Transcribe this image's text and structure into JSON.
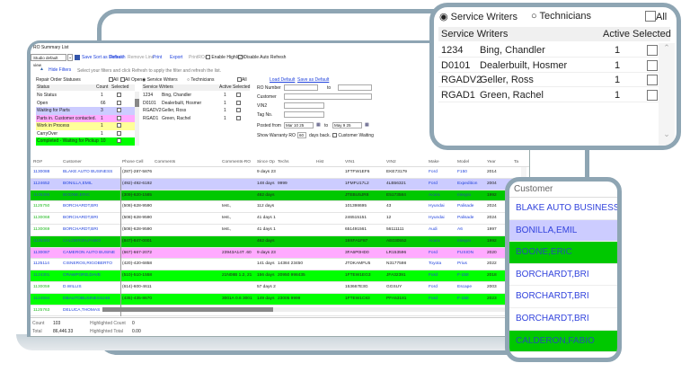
{
  "window": {
    "title": "RO Summary List"
  },
  "toolbar": {
    "view": "Studio default view",
    "save_sort": "Save Sort as Default",
    "refresh": "Refresh",
    "remove_line": "Remove Line",
    "print": "Print",
    "export": "Export",
    "print_ros": "PrintROs",
    "enable_highlight": "Enable Highlight",
    "disable_auto_refresh": "Disable Auto Refresh"
  },
  "filters": {
    "hide": "Hide Filters",
    "hint": "Select your filters and click Refresh to apply the filter and refresh the list.",
    "statuses_title": "Repair Order Statuses",
    "all": "All",
    "all_open": "All Open",
    "col_status": "Status",
    "col_count": "Count",
    "col_selected": "Selected",
    "statuses": [
      {
        "name": "No Status",
        "count": "1",
        "color": "#ffffff"
      },
      {
        "name": "Open",
        "count": "66",
        "color": "#ffffff"
      },
      {
        "name": "Waiting for Parts",
        "count": "3",
        "color": "#ccccff"
      },
      {
        "name": "Parts in. Customer contacted.",
        "count": "1",
        "color": "#ffaaff"
      },
      {
        "name": "Work in Process",
        "count": "1",
        "color": "#ffff99"
      },
      {
        "name": "CarryOver",
        "count": "1",
        "color": "#ffffff"
      },
      {
        "name": "Completed - Waiting for Pickup",
        "count": "10",
        "color": "#00ff00"
      }
    ],
    "service_writers_radio": "Service Writers",
    "technicians_radio": "Technicians",
    "col_sw": "Service Writers",
    "col_active": "Active",
    "writers": [
      {
        "code": "1234",
        "name": "Bing, Chandler",
        "active": "1"
      },
      {
        "code": "D0101",
        "name": "Dealerbuilt, Hosmer",
        "active": "1"
      },
      {
        "code": "RGADV2",
        "name": "Geller, Ross",
        "active": "1"
      },
      {
        "code": "RGAD1",
        "name": "Green, Rachel",
        "active": "1"
      }
    ],
    "load_default": "Load Default",
    "save_default": "Save as Default",
    "ro_number": "RO Number",
    "to": "to",
    "customer": "Customer",
    "vin2": "VIN2",
    "tag_no": "Tag No.",
    "posted_from": "Posted from",
    "posted_from_value": "Mar 10 25",
    "posted_to_value": "May 9 25",
    "show_warranty": "Show Warranty RO",
    "warranty_days": "60",
    "days_back": "days back.",
    "customer_waiting": "Customer Waiting"
  },
  "grid": {
    "headers": [
      "RO#",
      "Customer",
      "Phone Cell",
      "Comments",
      "Comments-RO",
      "Since Op",
      "Techs",
      "Hist",
      "VIN1",
      "VIN2",
      "Make",
      "Model",
      "Year",
      "Ta"
    ],
    "rows": [
      {
        "ro": "1130088",
        "customer": "BLAKE AUTO BUSINESS",
        "phone": "(287)-287-5876",
        "badge": "",
        "comments_ro": "",
        "since": "9 days 23",
        "techs": "",
        "vin1": "1FTFW1EF6",
        "vin2": "EKE73179",
        "make": "Ford",
        "model": "F150",
        "year": "2014",
        "bg": "#ffffff",
        "ro_color": "#2244dd"
      },
      {
        "ro": "1124652",
        "customer": "BONILLA,EMIL",
        "phone": "(492)-492-6192",
        "badge": "",
        "comments_ro": "",
        "since": "148 days",
        "techs": "9999",
        "vin1": "1FMFU17L2",
        "vin2": "4LB56321",
        "make": "Ford",
        "model": "Expedition",
        "year": "2004",
        "bg": "#ccccff",
        "ro_color": "#2244dd"
      },
      {
        "ro": "1125385",
        "customer": "BOONE,ERIC",
        "phone": "(309)-620-1585",
        "badge": "",
        "comments_ro": "",
        "since": "462 days",
        "techs": "",
        "vin1": "JTEBU5JR8",
        "vin2": "E5173584",
        "make": "Acura",
        "model": "Integra",
        "year": "1992",
        "bg": "#00c800",
        "ro_color": "#2266aa"
      },
      {
        "ro": "1125750",
        "customer": "BORCHARDT,BRI",
        "phone": "(508)-628-9590",
        "badge": "3",
        "comments_ro": "test.,",
        "since": "112 days",
        "techs": "",
        "vin1": "101398695",
        "vin2": "43",
        "make": "Hyundai",
        "model": "Palisade",
        "year": "2024",
        "bg": "#ffffff",
        "ro_color": "#22bb22"
      },
      {
        "ro": "1130068",
        "customer": "BORCHARDT,BRI",
        "phone": "(508)-628-9590",
        "badge": "3",
        "comments_ro": "test.,",
        "since": "41 days 1",
        "techs": "",
        "vin1": "246515151",
        "vin2": "12",
        "make": "Hyundai",
        "model": "Palisade",
        "year": "2024",
        "bg": "#ffffff",
        "ro_color": "#22bb22"
      },
      {
        "ro": "1130069",
        "customer": "BORCHARDT,BRI",
        "phone": "(508)-628-9590",
        "badge": "3",
        "comments_ro": "test.,",
        "since": "41 days 1",
        "techs": "",
        "vin1": "651491561",
        "vin2": "56111111",
        "make": "Audi",
        "model": "A6",
        "year": "1997",
        "bg": "#ffffff",
        "ro_color": "#22bb22"
      },
      {
        "ro": "1125393",
        "customer": "CALDERON,FABIO",
        "phone": "(847)-847-0001",
        "badge": "",
        "comments_ro": "",
        "since": "462 days",
        "techs": "",
        "vin1": "19XFA1F87",
        "vin2": "AE030552",
        "make": "Acura",
        "model": "Integra",
        "year": "1992",
        "bg": "#00c800",
        "ro_color": "#2266aa"
      },
      {
        "ro": "1130087",
        "customer": "CAMERON AUTO BUSINE",
        "phone": "(667)-667-2072",
        "badge": "1",
        "comments_ro": "23943A14T .60",
        "since": "9 days 23",
        "techs": "",
        "vin1": "3FA6P0HD0",
        "vin2": "LR153596",
        "make": "Ford",
        "model": "FUSION",
        "year": "2020",
        "bg": "#ffaaff",
        "ro_color": "#2244dd"
      },
      {
        "ro": "1125114",
        "customer": "CISNEROS,RIGOBERTO",
        "phone": "(420)-420-6858",
        "badge": "",
        "comments_ro": "",
        "since": "141 days",
        "techs": "14384 23450",
        "vin1": "JTDKAMFU5",
        "vin2": "N3177598",
        "make": "Toyota",
        "model": "Prius",
        "year": "2022",
        "bg": "#ffffff",
        "ro_color": "#2244dd"
      },
      {
        "ro": "1124301",
        "customer": "CRAWFORD,DAVE",
        "phone": "(510)-510-1558",
        "badge": "4",
        "comments_ro": "21N08B 1.2, 21",
        "since": "156 days",
        "techs": "20950 998435",
        "vin1": "1FTEW1EG3",
        "vin2": "JFA32391",
        "make": "Ford",
        "model": "F-150",
        "year": "2018",
        "bg": "#00ff00",
        "ro_color": "#2266aa"
      },
      {
        "ro": "1130059",
        "customer": "D.WILLIS",
        "phone": "(614)-600-4611",
        "badge": "",
        "comments_ro": "",
        "since": "57 days 2",
        "techs": "",
        "vin1": "153667E3G",
        "vin2": "GGSUY",
        "make": "Ford",
        "model": "Escape",
        "year": "2003",
        "bg": "#ffffff",
        "ro_color": "#22bb22"
      },
      {
        "ro": "1124594",
        "customer": "DBAUTOBUSINESS248",
        "phone": "(435)-435-8670",
        "badge": "1",
        "comments_ro": "3001A 0.6 3001",
        "since": "149 days",
        "techs": "23005 9999",
        "vin1": "1FTEW1C83",
        "vin2": "PFA53181",
        "make": "Ford",
        "model": "F-150",
        "year": "2023",
        "bg": "#00ff00",
        "ro_color": "#2266aa"
      },
      {
        "ro": "1125763",
        "customer": "DELUCA,THOMAS",
        "phone": "",
        "badge": "",
        "comments_ro": "",
        "since": "",
        "techs": "",
        "vin1": "",
        "vin2": "",
        "make": "",
        "model": "",
        "year": "",
        "bg": "#ffffff",
        "ro_color": "#22bb22"
      }
    ]
  },
  "footer": {
    "count_label": "Count",
    "count": "103",
    "total_label": "Total",
    "total": "86,446.33",
    "hl_count_label": "Highlighted Count",
    "hl_count": "0",
    "hl_total_label": "Highlighted Total",
    "hl_total": "0.00"
  },
  "zoom_writers": {
    "sw_radio": "Service Writers",
    "tech_radio": "Technicians",
    "all": "All",
    "col_sw": "Service Writers",
    "col_active": "Active",
    "col_selected": "Selected"
  },
  "zoom_customers": {
    "header": "Customer",
    "rows": [
      {
        "name": "BLAKE AUTO BUSINESS",
        "bg": "#ffffff"
      },
      {
        "name": "BONILLA,EMIL",
        "bg": "#ccccff"
      },
      {
        "name": "BOONE,ERIC",
        "bg": "#00c800"
      },
      {
        "name": "BORCHARDT,BRI",
        "bg": "#ffffff"
      },
      {
        "name": "BORCHARDT,BRI",
        "bg": "#ffffff"
      },
      {
        "name": "BORCHARDT,BRI",
        "bg": "#ffffff"
      },
      {
        "name": "CALDERON,FABIO",
        "bg": "#00c800"
      }
    ]
  }
}
